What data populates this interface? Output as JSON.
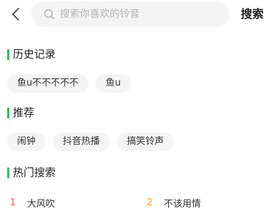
{
  "search": {
    "placeholder": "搜索你喜欢的铃音",
    "value": "",
    "button_label": "搜索",
    "back_icon": "chevron-left-icon",
    "search_icon": "search-icon"
  },
  "history": {
    "title": "历史记录",
    "items": [
      "鱼u不不不不不",
      "鱼u"
    ]
  },
  "recommend": {
    "title": "推荐",
    "items": [
      "闹钟",
      "抖音热播",
      "搞笑铃声"
    ]
  },
  "hot": {
    "title": "热门搜索",
    "items": [
      {
        "rank": "1",
        "name": "大风吹",
        "color": "#ff5a5a"
      },
      {
        "rank": "2",
        "name": "不该用情",
        "color": "#ff9a2e"
      }
    ]
  },
  "colors": {
    "accent": "#22c35e",
    "chip_bg": "#f4f4f4"
  }
}
